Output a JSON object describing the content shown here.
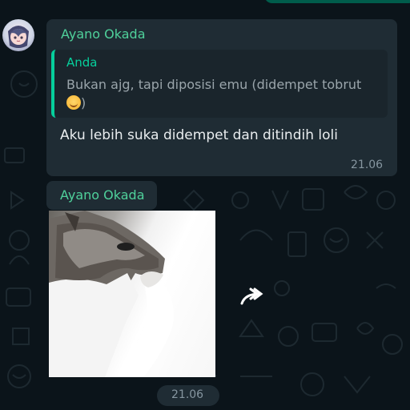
{
  "messages": [
    {
      "sender": "Ayano Okada",
      "reply": {
        "author": "Anda",
        "text": "Bukan ajg, tapi diposisi emu (didempet tobrut",
        "emoji": "smiling-face-icon"
      },
      "text": "Aku lebih suka didempet dan ditindih loli",
      "time": "21.06"
    },
    {
      "sender": "Ayano Okada",
      "image": "cat-thinking-image",
      "time": "21.06"
    }
  ],
  "colors": {
    "background": "#0b141a",
    "bubble": "#1f2c34",
    "accent": "#06cf9c",
    "sender": "#4fd19b",
    "text": "#e9edef",
    "muted": "#8696a0"
  }
}
